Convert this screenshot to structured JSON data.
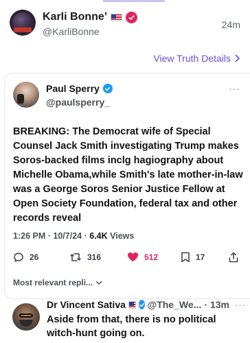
{
  "post": {
    "author_name": "Karli Bonne’",
    "author_handle": "@KarliBonne",
    "time": "24m",
    "view_details": "View Truth Details",
    "icons": {
      "avatar": "avatar-image",
      "flag": "us-flag-icon",
      "verified": "verified-badge-icon",
      "chevron": "chevron-right-icon"
    },
    "colors": {
      "link": "#6b4fd8",
      "verified": "#e0245e"
    }
  },
  "quote": {
    "author_name": "Paul Sperry",
    "author_handle": "@paulsperry_",
    "more": "···",
    "body": "BREAKING: The Democrat wife of Special Counsel Jack Smith investigating Trump makes Soros-backed films inclg hagiography about Michelle Obama,while Smith's late mother-in-law was a George Soros Senior Justice Fellow at Open Society Foundation, federal tax and other records reveal",
    "time": "1:26 PM",
    "date": "10/7/24",
    "views_count": "6.4K",
    "views_label": "Views",
    "separator": "·",
    "actions": {
      "replies": "26",
      "reposts": "316",
      "likes": "512",
      "bookmarks": "17"
    },
    "sort_label": "Most relevant repli...",
    "colors": {
      "verified": "#1d9bf0",
      "like": "#e0245e"
    }
  },
  "reply": {
    "author_name": "Dr Vincent Sativa",
    "author_handle": "@The_We...",
    "separator": "·",
    "time": "13m",
    "more": "···",
    "text": "Aside from that, there is no political witch-hunt going on."
  }
}
